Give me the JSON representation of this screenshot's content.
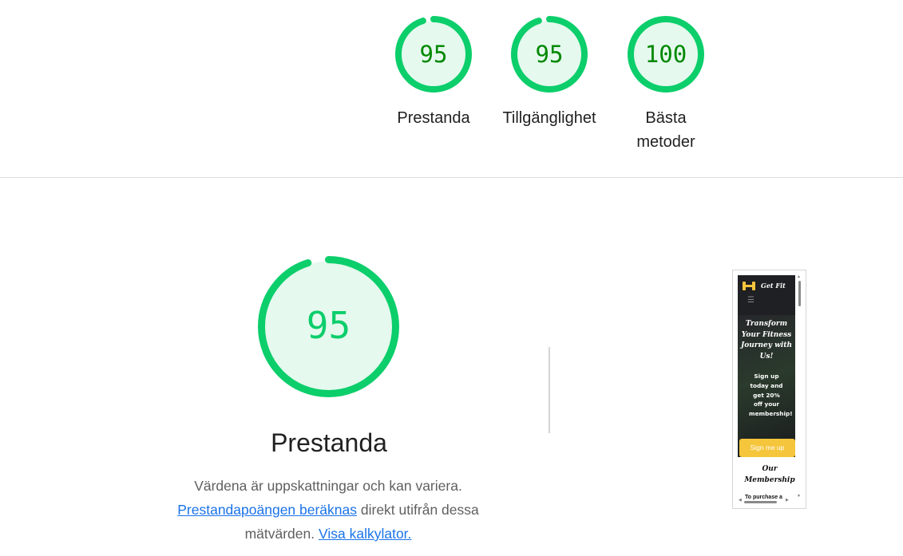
{
  "scores": [
    {
      "value": "95",
      "label": "Prestanda",
      "fraction": 0.95,
      "color": "#0cce6b",
      "bg": "#e5f9ee",
      "text_color": "#008800"
    },
    {
      "value": "95",
      "label": "Tillgänglighet",
      "fraction": 0.95,
      "color": "#0cce6b",
      "bg": "#e5f9ee",
      "text_color": "#008800"
    },
    {
      "value": "100",
      "label": "Bästa metoder",
      "fraction": 1.0,
      "color": "#0cce6b",
      "bg": "#e5f9ee",
      "text_color": "#008800"
    }
  ],
  "performance": {
    "score": "95",
    "fraction": 0.95,
    "title": "Prestanda",
    "description_prefix": "Värdena är uppskattningar och kan variera.",
    "link_score": "Prestandapoängen beräknas",
    "description_mid": " direkt utifrån dessa mätvärden.",
    "link_calculator": "Visa kalkylator.",
    "color": "#0cce6b",
    "bg": "#e5f9ee"
  },
  "screenshot": {
    "brand": "Get Fit",
    "menu_icon": "hamburger-icon",
    "logo_icon": "dumbbell-icon",
    "hero_title": "Transform Your Fitness Journey with Us!",
    "hero_sub": "Sign up today and get 20% off your membership!",
    "cta": "Sign me up",
    "section_title": "Our Membership",
    "cut_text": "To purchase a",
    "accent": "#f5c53c"
  }
}
